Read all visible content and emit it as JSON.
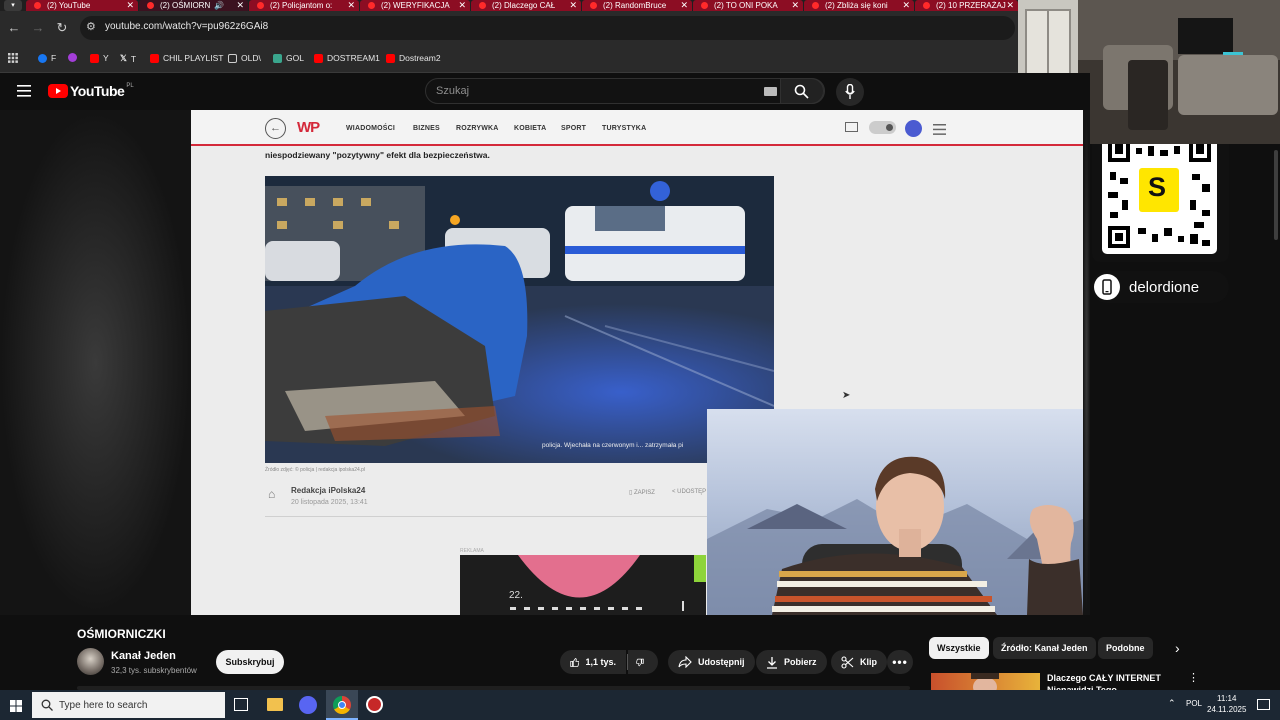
{
  "browser": {
    "tabs": [
      {
        "title": "(2) YouTube"
      },
      {
        "title": "(2) OŚMIORN"
      },
      {
        "title": "(2) Policjantom o:"
      },
      {
        "title": "(2) WERYFIKACJA"
      },
      {
        "title": "(2) Dlaczego CAŁ"
      },
      {
        "title": "(2) RandomBruce"
      },
      {
        "title": "(2) TO ONI POKA"
      },
      {
        "title": "(2) Zbliża się koni"
      },
      {
        "title": "(2) 10 PRZERAŻAJ"
      }
    ],
    "url": "youtube.com/watch?v=pu962z6GAi8",
    "bookmarks": [
      {
        "label": "F",
        "icon": "facebook-icon",
        "color": "#1877f2"
      },
      {
        "label": "Y",
        "icon": "youtube-icon",
        "color": "#ff0000"
      },
      {
        "label": "T",
        "icon": "x-icon",
        "color": "#000000"
      },
      {
        "label": "CHIL PLAYLIST",
        "icon": "youtube-icon",
        "color": "#ff0000"
      },
      {
        "label": "OLD\\",
        "icon": "folder-icon",
        "color": "#cfcfcf"
      },
      {
        "label": "GOL",
        "icon": "gol-icon",
        "color": "#3aa68d"
      },
      {
        "label": "DOSTREAM1",
        "icon": "youtube-icon",
        "color": "#ff0000"
      },
      {
        "label": "Dostream2",
        "icon": "youtube-icon",
        "color": "#ff0000"
      }
    ]
  },
  "youtube": {
    "logo_text": "YouTube",
    "region": "PL",
    "search_placeholder": "Szukaj"
  },
  "article": {
    "nav_items": [
      "WIADOMOŚCI",
      "BIZNES",
      "ROZRYWKA",
      "KOBIETA",
      "SPORT",
      "TURYSTYKA"
    ],
    "text_line": "niespodziewany \"pozytywny\" efekt dla bezpieczeństwa.",
    "photo_caption": "policja. Wjechała na czerwonym i... zatrzymała pi",
    "photo_credit": "Źródło zdjęć: © policja | redakcja ipolska24.pl",
    "author": "Redakcja iPolska24",
    "date": "20 listopada 2025, 13:41",
    "save_label": "ZAPISZ",
    "share_label": "UDOSTĘP",
    "ad_label": "REKLAMA",
    "ad_number": "22."
  },
  "stream_overlay": {
    "handle": "delordione",
    "qr_logo_letter": "S",
    "qr_logo_color": "#ffe600"
  },
  "video": {
    "title": "OŚMIORNICZKI",
    "channel": "Kanał Jeden",
    "subscribers": "32,3 tys. subskrybentów",
    "subscribe_label": "Subskrybuj",
    "likes": "1,1 tys.",
    "share_label": "Udostępnij",
    "download_label": "Pobierz",
    "clip_label": "Klip"
  },
  "recommendations": {
    "chips": [
      "Wszystkie",
      "Źródło: Kanał Jeden",
      "Podobne"
    ],
    "first_title": "Dlaczego CAŁY INTERNET Nienawidzi Tego STREAMERA?"
  },
  "taskbar": {
    "search_placeholder": "Type here to search",
    "language": "POL",
    "time": "11:14",
    "date": "24.11.2025"
  },
  "colors": {
    "tab_red": "#8c0d23",
    "youtube_red": "#ff0000",
    "wp_red": "#d4293a"
  }
}
